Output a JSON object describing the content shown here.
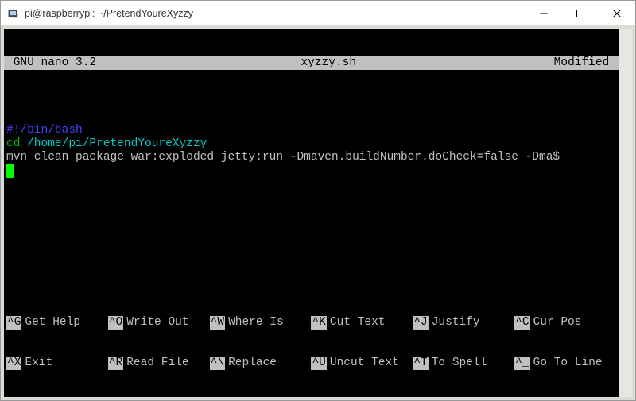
{
  "window": {
    "title": "pi@raspberrypi: ~/PretendYoureXyzzy"
  },
  "nano": {
    "header_left": " GNU nano 3.2 ",
    "header_center": "xyzzy.sh",
    "header_right": "Modified "
  },
  "content": {
    "line1": "#!/bin/bash",
    "line2_cmd": "cd",
    "line2_path": " /home/pi/PretendYoureXyzzy",
    "line3": "mvn clean package war:exploded jetty:run -Dmaven.buildNumber.doCheck=false -Dma$"
  },
  "shortcuts": {
    "row1": [
      {
        "key": "^G",
        "label": "Get Help"
      },
      {
        "key": "^O",
        "label": "Write Out"
      },
      {
        "key": "^W",
        "label": "Where Is"
      },
      {
        "key": "^K",
        "label": "Cut Text"
      },
      {
        "key": "^J",
        "label": "Justify"
      },
      {
        "key": "^C",
        "label": "Cur Pos"
      }
    ],
    "row2": [
      {
        "key": "^X",
        "label": "Exit"
      },
      {
        "key": "^R",
        "label": "Read File"
      },
      {
        "key": "^\\",
        "label": "Replace"
      },
      {
        "key": "^U",
        "label": "Uncut Text"
      },
      {
        "key": "^T",
        "label": "To Spell"
      },
      {
        "key": "^_",
        "label": "Go To Line"
      }
    ]
  }
}
